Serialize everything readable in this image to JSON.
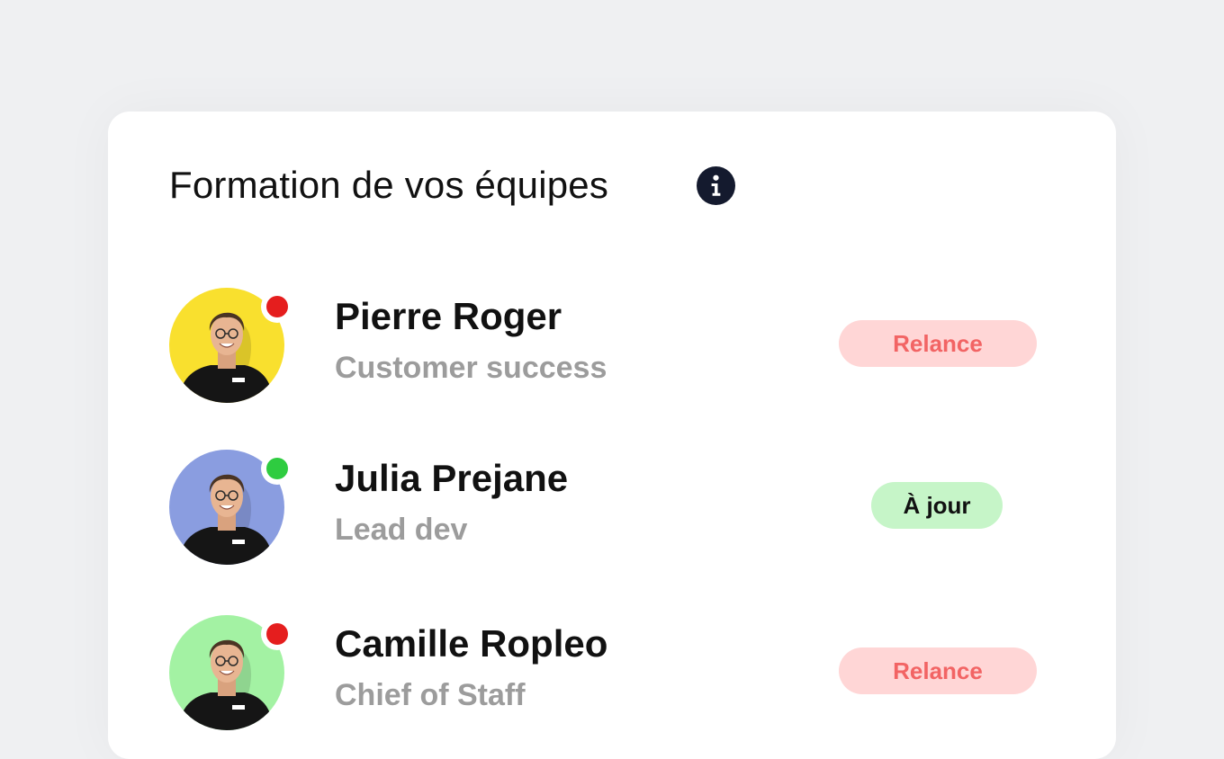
{
  "panel": {
    "title": "Formation de vos équipes",
    "info_icon": "info-circle-icon"
  },
  "colors": {
    "relance_bg": "#ffd6d6",
    "relance_text": "#f26464",
    "ajour_bg": "#c6f5c8",
    "status_red": "#e51e1e",
    "status_green": "#2ecc40"
  },
  "team": [
    {
      "name": "Pierre Roger",
      "role": "Customer success",
      "avatar_bg": "#f9e02e",
      "status": "red",
      "status_color": "#e51e1e",
      "action": "Relance"
    },
    {
      "name": "Julia Prejane",
      "role": "Lead dev",
      "avatar_bg": "#8a9de0",
      "status": "green",
      "status_color": "#2ecc40",
      "action": "À jour"
    },
    {
      "name": "Camille Ropleo",
      "role": "Chief of Staff",
      "avatar_bg": "#a3f2a3",
      "status": "red",
      "status_color": "#e51e1e",
      "action": "Relance"
    }
  ]
}
